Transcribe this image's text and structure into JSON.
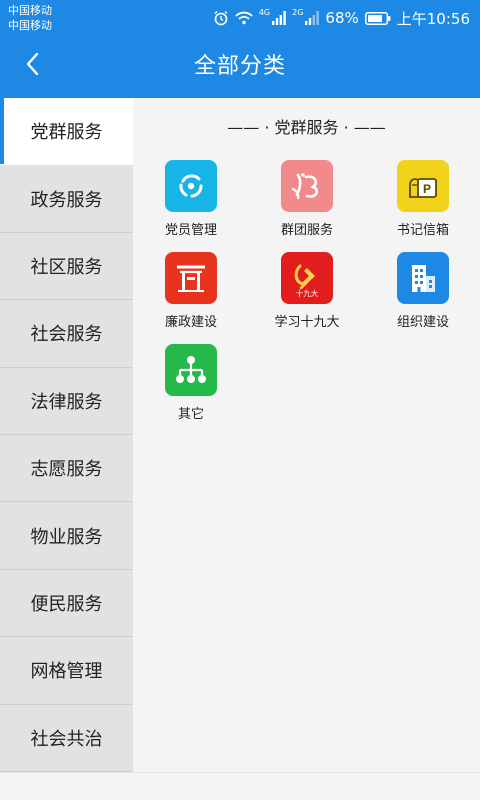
{
  "status_bar": {
    "carrier_1": "中国移动",
    "carrier_2": "中国移动",
    "net_tag_1": "4G",
    "net_tag_2": "2G",
    "battery": "68%",
    "time": "上午10:56"
  },
  "header": {
    "title": "全部分类",
    "back_icon": "chevron-left-icon"
  },
  "sidebar": {
    "items": [
      {
        "label": "党群服务",
        "active": true
      },
      {
        "label": "政务服务"
      },
      {
        "label": "社区服务"
      },
      {
        "label": "社会服务"
      },
      {
        "label": "法律服务"
      },
      {
        "label": "志愿服务"
      },
      {
        "label": "物业服务"
      },
      {
        "label": "便民服务"
      },
      {
        "label": "网格管理"
      },
      {
        "label": "社会共治"
      }
    ]
  },
  "content": {
    "section_title": "—— · 党群服务 · ——",
    "tiles": [
      {
        "label": "党员管理",
        "icon": "member-management-icon",
        "color": "#17b4e8"
      },
      {
        "label": "群团服务",
        "icon": "group-service-icon",
        "color": "#f28a8c"
      },
      {
        "label": "书记信箱",
        "icon": "mailbox-icon",
        "color": "#f2d31c"
      },
      {
        "label": "廉政建设",
        "icon": "gate-icon",
        "color": "#e8331f"
      },
      {
        "label": "学习十九大",
        "icon": "party-emblem-icon",
        "color": "#e21d1d",
        "icon_text": "十九大"
      },
      {
        "label": "组织建设",
        "icon": "building-icon",
        "color": "#1e88e5"
      },
      {
        "label": "其它",
        "icon": "org-tree-icon",
        "color": "#25b84a"
      }
    ]
  },
  "colors": {
    "primary": "#1e88e5",
    "sidebar_bg": "#e2e2e2",
    "content_bg": "#f4f4f4"
  }
}
